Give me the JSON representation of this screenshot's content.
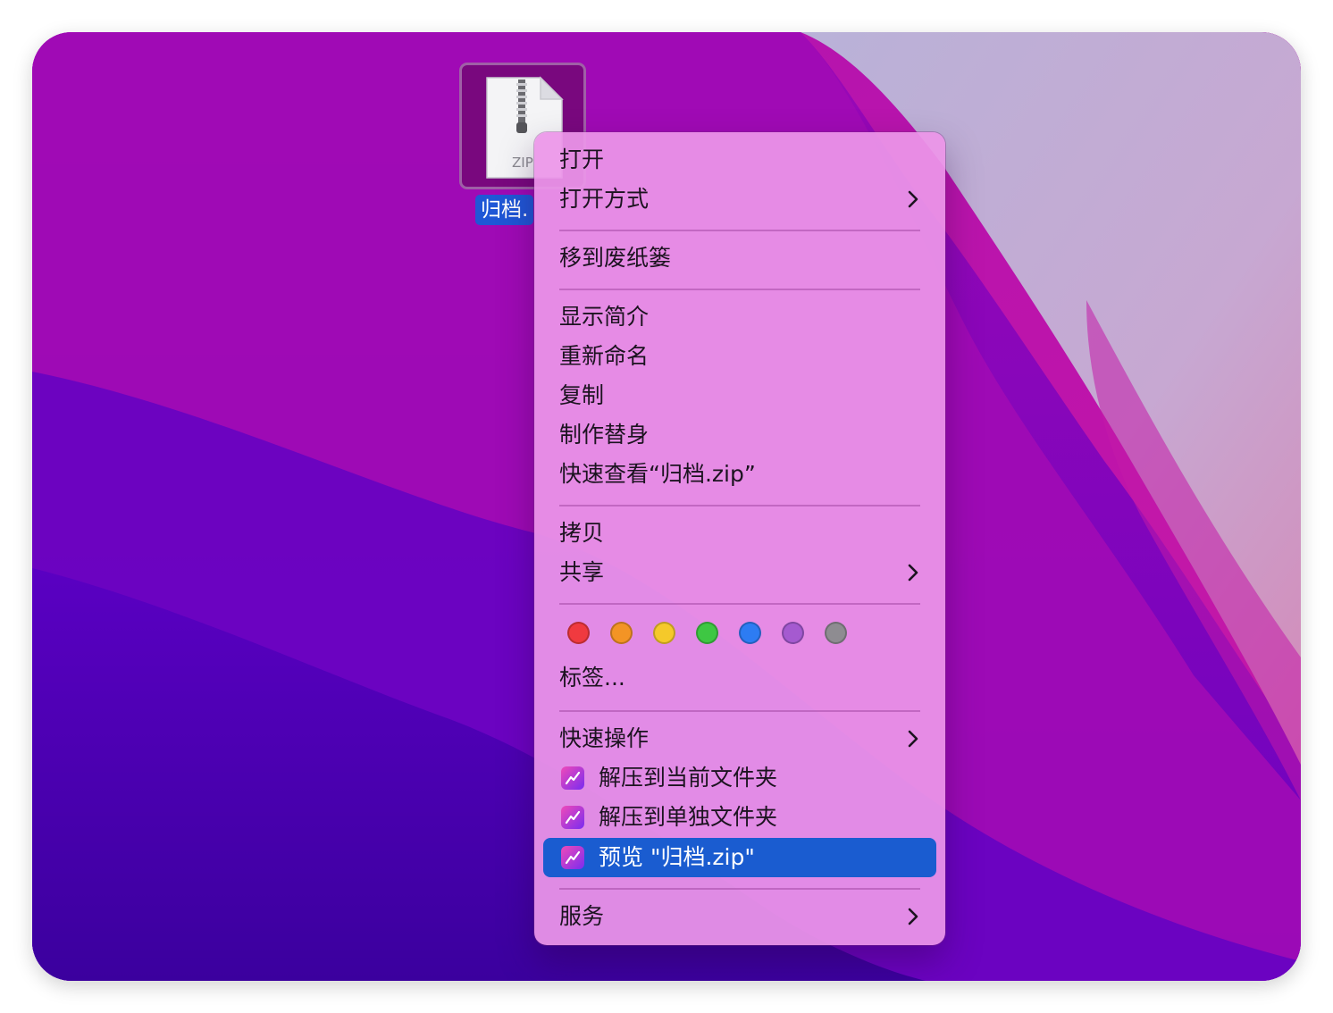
{
  "desktop": {
    "file": {
      "name": "归档.",
      "icon_text": "ZIP"
    }
  },
  "menu": {
    "items": [
      {
        "label": "打开",
        "submenu": false
      },
      {
        "label": "打开方式",
        "submenu": true
      },
      {
        "label": "移到废纸篓",
        "submenu": false
      },
      {
        "label": "显示简介",
        "submenu": false
      },
      {
        "label": "重新命名",
        "submenu": false
      },
      {
        "label": "复制",
        "submenu": false
      },
      {
        "label": "制作替身",
        "submenu": false
      },
      {
        "label": "快速查看“归档.zip”",
        "submenu": false
      },
      {
        "label": "拷贝",
        "submenu": false
      },
      {
        "label": "共享",
        "submenu": true
      },
      {
        "label": "标签...",
        "submenu": false
      },
      {
        "label": "快速操作",
        "submenu": true
      },
      {
        "label": "解压到当前文件夹",
        "submenu": false,
        "icon": "unarchiver-icon"
      },
      {
        "label": "解压到单独文件夹",
        "submenu": false,
        "icon": "unarchiver-icon"
      },
      {
        "label": "预览 \"归档.zip\"",
        "submenu": false,
        "icon": "unarchiver-icon",
        "selected": true
      },
      {
        "label": "服务",
        "submenu": true
      }
    ],
    "tag_colors": [
      {
        "name": "red",
        "color": "#f03a3f"
      },
      {
        "name": "orange",
        "color": "#f39425"
      },
      {
        "name": "yellow",
        "color": "#f5c92a"
      },
      {
        "name": "green",
        "color": "#3ec743"
      },
      {
        "name": "blue",
        "color": "#2d7cf3"
      },
      {
        "name": "purple",
        "color": "#a55ad0"
      },
      {
        "name": "gray",
        "color": "#8e8c91"
      }
    ]
  },
  "colors": {
    "selection": "#1a5cd0",
    "file_label_bg": "#1f57d6"
  }
}
